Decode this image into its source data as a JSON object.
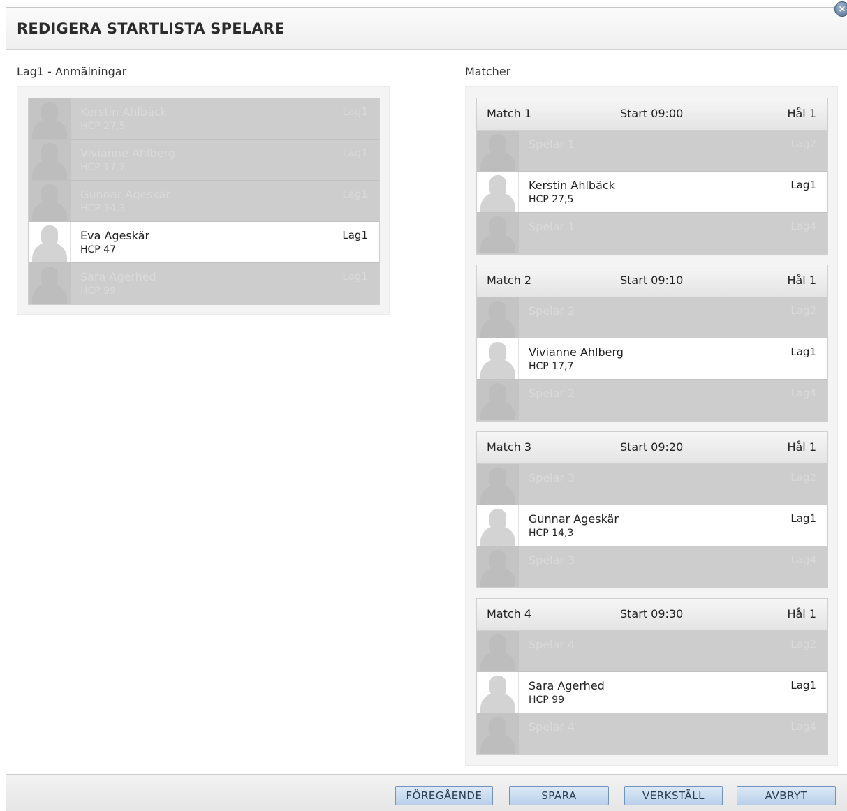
{
  "dialog": {
    "title": "REDIGERA STARTLISTA SPELARE",
    "close_glyph": "×"
  },
  "left": {
    "label": "Lag1 - Anmälningar",
    "players": [
      {
        "name": "Kerstin Ahlbäck",
        "hcp": "HCP 27,5",
        "team": "Lag1",
        "active": false
      },
      {
        "name": "Vivianne Ahlberg",
        "hcp": "HCP 17,7",
        "team": "Lag1",
        "active": false
      },
      {
        "name": "Gunnar Ageskär",
        "hcp": "HCP 14,3",
        "team": "Lag1",
        "active": false
      },
      {
        "name": "Eva Ageskär",
        "hcp": "HCP 47",
        "team": "Lag1",
        "active": true
      },
      {
        "name": "Sara Agerhed",
        "hcp": "HCP 99",
        "team": "Lag1",
        "active": false
      }
    ]
  },
  "right": {
    "label": "Matcher",
    "matches": [
      {
        "name": "Match 1",
        "start": "Start 09:00",
        "hole": "Hål 1",
        "slots": [
          {
            "name": "Spelar 1",
            "hcp": "",
            "team": "Lag2",
            "active": false
          },
          {
            "name": "Kerstin Ahlbäck",
            "hcp": "HCP 27,5",
            "team": "Lag1",
            "active": true
          },
          {
            "name": "Spelar 1",
            "hcp": "",
            "team": "Lag4",
            "active": false
          }
        ]
      },
      {
        "name": "Match 2",
        "start": "Start 09:10",
        "hole": "Hål 1",
        "slots": [
          {
            "name": "Spelar 2",
            "hcp": "",
            "team": "Lag2",
            "active": false
          },
          {
            "name": "Vivianne Ahlberg",
            "hcp": "HCP 17,7",
            "team": "Lag1",
            "active": true
          },
          {
            "name": "Spelar 2",
            "hcp": "",
            "team": "Lag4",
            "active": false
          }
        ]
      },
      {
        "name": "Match 3",
        "start": "Start 09:20",
        "hole": "Hål 1",
        "slots": [
          {
            "name": "Spelar 3",
            "hcp": "",
            "team": "Lag2",
            "active": false
          },
          {
            "name": "Gunnar Ageskär",
            "hcp": "HCP 14,3",
            "team": "Lag1",
            "active": true
          },
          {
            "name": "Spelar 3",
            "hcp": "",
            "team": "Lag4",
            "active": false
          }
        ]
      },
      {
        "name": "Match 4",
        "start": "Start 09:30",
        "hole": "Hål 1",
        "slots": [
          {
            "name": "Spelar 4",
            "hcp": "",
            "team": "Lag2",
            "active": false
          },
          {
            "name": "Sara Agerhed",
            "hcp": "HCP 99",
            "team": "Lag1",
            "active": true
          },
          {
            "name": "Spelar 4",
            "hcp": "",
            "team": "Lag4",
            "active": false
          }
        ]
      }
    ]
  },
  "footer": {
    "previous_label": "FÖREGÅENDE",
    "save_label": "SPARA",
    "apply_label": "VERKSTÄLL",
    "cancel_label": "AVBRYT"
  }
}
